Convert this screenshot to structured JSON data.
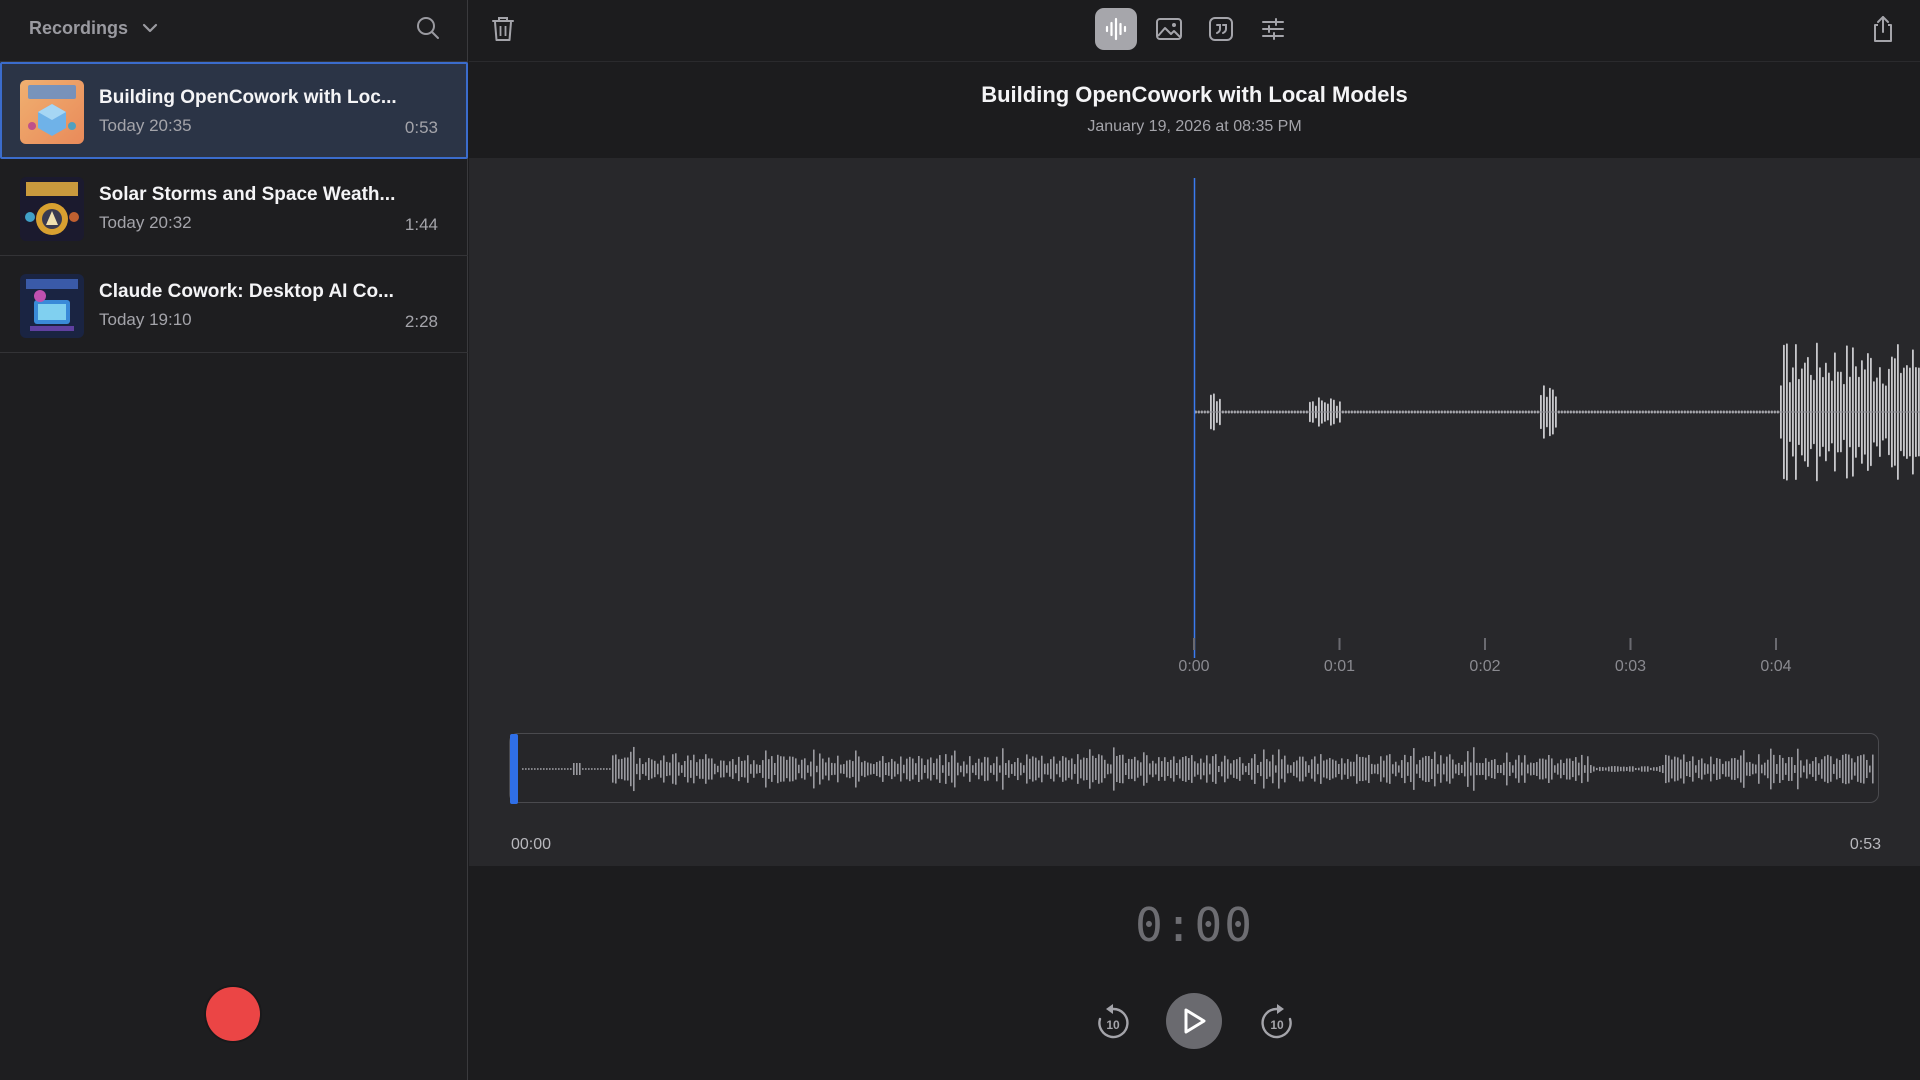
{
  "sidebar": {
    "title": "Recordings",
    "recordings": [
      {
        "title": "Building OpenCowork with Loc...",
        "date": "Today 20:35",
        "duration": "0:53",
        "selected": true,
        "thumb": "building-opencowork"
      },
      {
        "title": "Solar Storms and Space Weath...",
        "date": "Today 20:32",
        "duration": "1:44",
        "selected": false,
        "thumb": "solar-storms"
      },
      {
        "title": "Claude Cowork: Desktop AI Co...",
        "date": "Today 19:10",
        "duration": "2:28",
        "selected": false,
        "thumb": "claude-cowork"
      }
    ],
    "record_color": "#eb4545"
  },
  "toolbar": {
    "left_icons": [
      "trash-icon"
    ],
    "center_icons": [
      "waveform-icon",
      "image-icon",
      "quote-icon",
      "sliders-icon"
    ],
    "active": "waveform-icon",
    "right_icons": [
      "share-icon"
    ]
  },
  "recording": {
    "title": "Building OpenCowork with Local Models",
    "date": "January 19, 2026 at 08:35 PM"
  },
  "timeline": {
    "ticks": [
      "0:00",
      "0:01",
      "0:02",
      "0:03",
      "0:04"
    ],
    "playhead_color": "#3a7bf0"
  },
  "overview": {
    "start": "00:00",
    "end": "0:53",
    "progress": 0
  },
  "player": {
    "time": "0:00",
    "skip_back": "10",
    "skip_forward": "10"
  }
}
